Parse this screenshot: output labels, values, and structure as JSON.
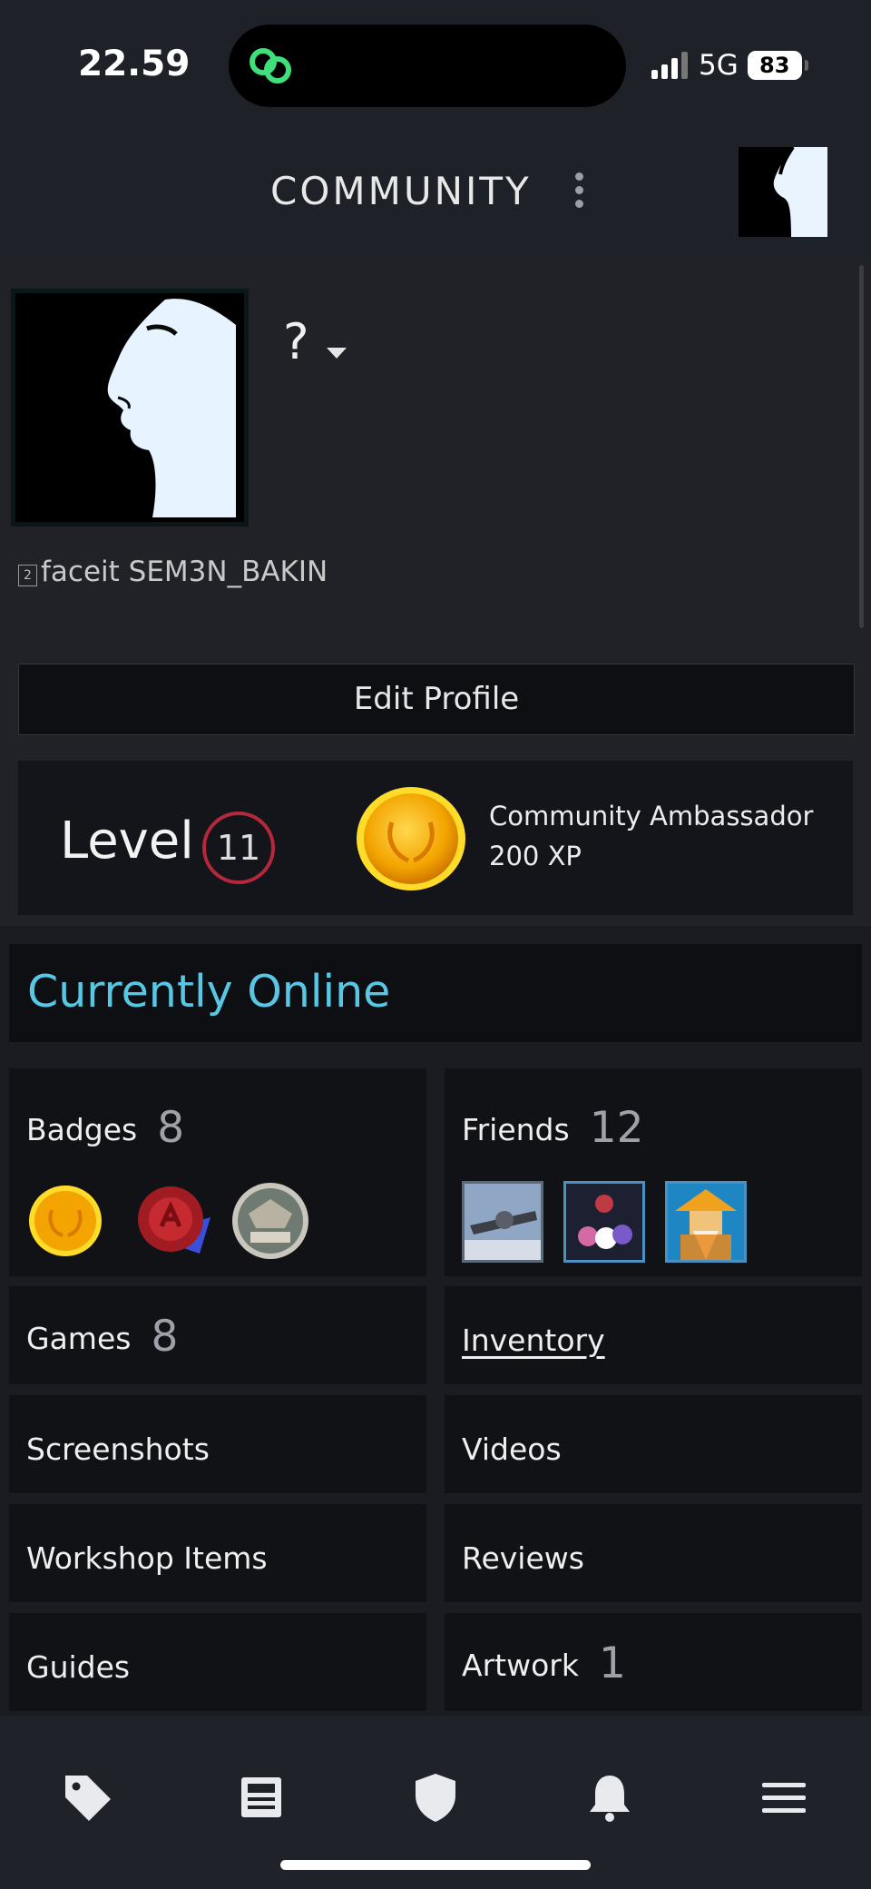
{
  "status_bar": {
    "time": "22.59",
    "network": "5G",
    "battery": "83"
  },
  "header": {
    "title": "COMMUNITY"
  },
  "profile": {
    "persona_name": "?",
    "real_name": "faceit SEM3N_BAKIN",
    "real_name_glyph": "2",
    "edit_label": "Edit Profile"
  },
  "level": {
    "label": "Level",
    "value": "11",
    "badge_name": "Community Ambassador",
    "badge_xp": "200 XP"
  },
  "status_text": "Currently Online",
  "tiles": {
    "badges": {
      "label": "Badges",
      "count": "8"
    },
    "friends": {
      "label": "Friends",
      "count": "12"
    },
    "games": {
      "label": "Games",
      "count": "8"
    },
    "inventory": {
      "label": "Inventory"
    },
    "screenshots": {
      "label": "Screenshots"
    },
    "videos": {
      "label": "Videos"
    },
    "workshop": {
      "label": "Workshop Items"
    },
    "reviews": {
      "label": "Reviews"
    },
    "guides": {
      "label": "Guides"
    },
    "artwork": {
      "label": "Artwork",
      "count": "1"
    }
  },
  "badge_icons": [
    "ambassador-coin-icon",
    "wax-seal-badge-icon",
    "csgo-badge-icon"
  ],
  "bottom_nav": [
    "tag-icon",
    "news-icon",
    "shield-icon",
    "bell-icon",
    "menu-icon"
  ],
  "colors": {
    "accent_online": "#57c7e3",
    "level_ring": "#b5283c",
    "background": "#1b1c21"
  }
}
